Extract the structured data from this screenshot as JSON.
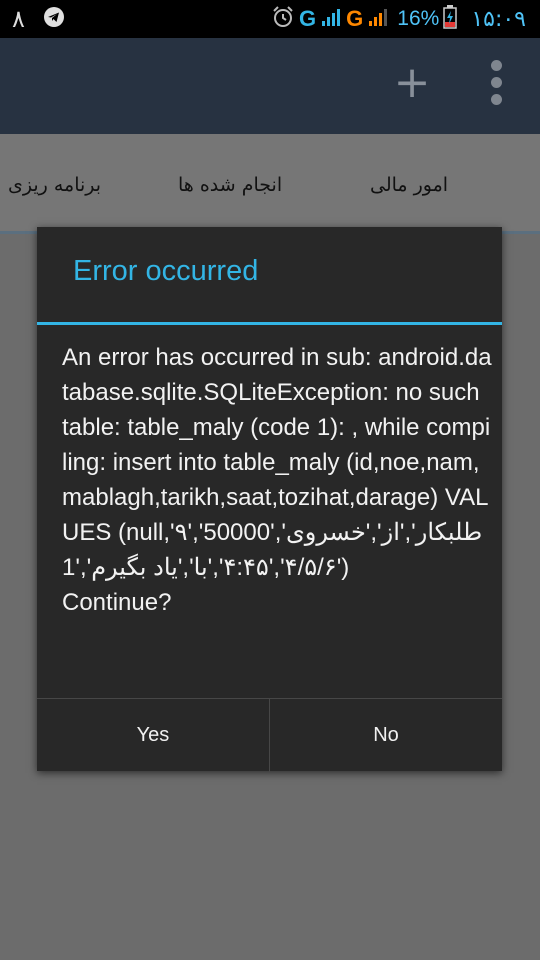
{
  "status_bar": {
    "notification_count": "۸",
    "notification_icon": "telegram-icon",
    "alarm_icon": "alarm-clock-icon",
    "network1": "G",
    "network2": "G",
    "battery_percent": "16%",
    "time": "۱۵:۰۹",
    "colors": {
      "network1": "#33b5e5",
      "network2": "#ff8800",
      "accent": "#33b5e5"
    }
  },
  "action_bar": {
    "add_icon": "plus-icon",
    "overflow_icon": "overflow-menu-icon"
  },
  "tabs": [
    {
      "label": "امور مالی"
    },
    {
      "label": "انجام شده ها"
    },
    {
      "label": "برنامه ریزی"
    }
  ],
  "dialog": {
    "title": "Error occurred",
    "message": "An error has occurred in sub: android.database.sqlite.SQLiteException: no such table: table_maly (code 1): , while compiling: insert into table_maly (id,noe,nam,mablagh,tarikh,saat,tozihat,darage) VALUES (null,'طلبکار','از','خسروی','50000','۹۴/۵/۶','۴:۴۵','با','یاد بگیرم','1')",
    "question": "Continue?",
    "yes_label": "Yes",
    "no_label": "No"
  }
}
